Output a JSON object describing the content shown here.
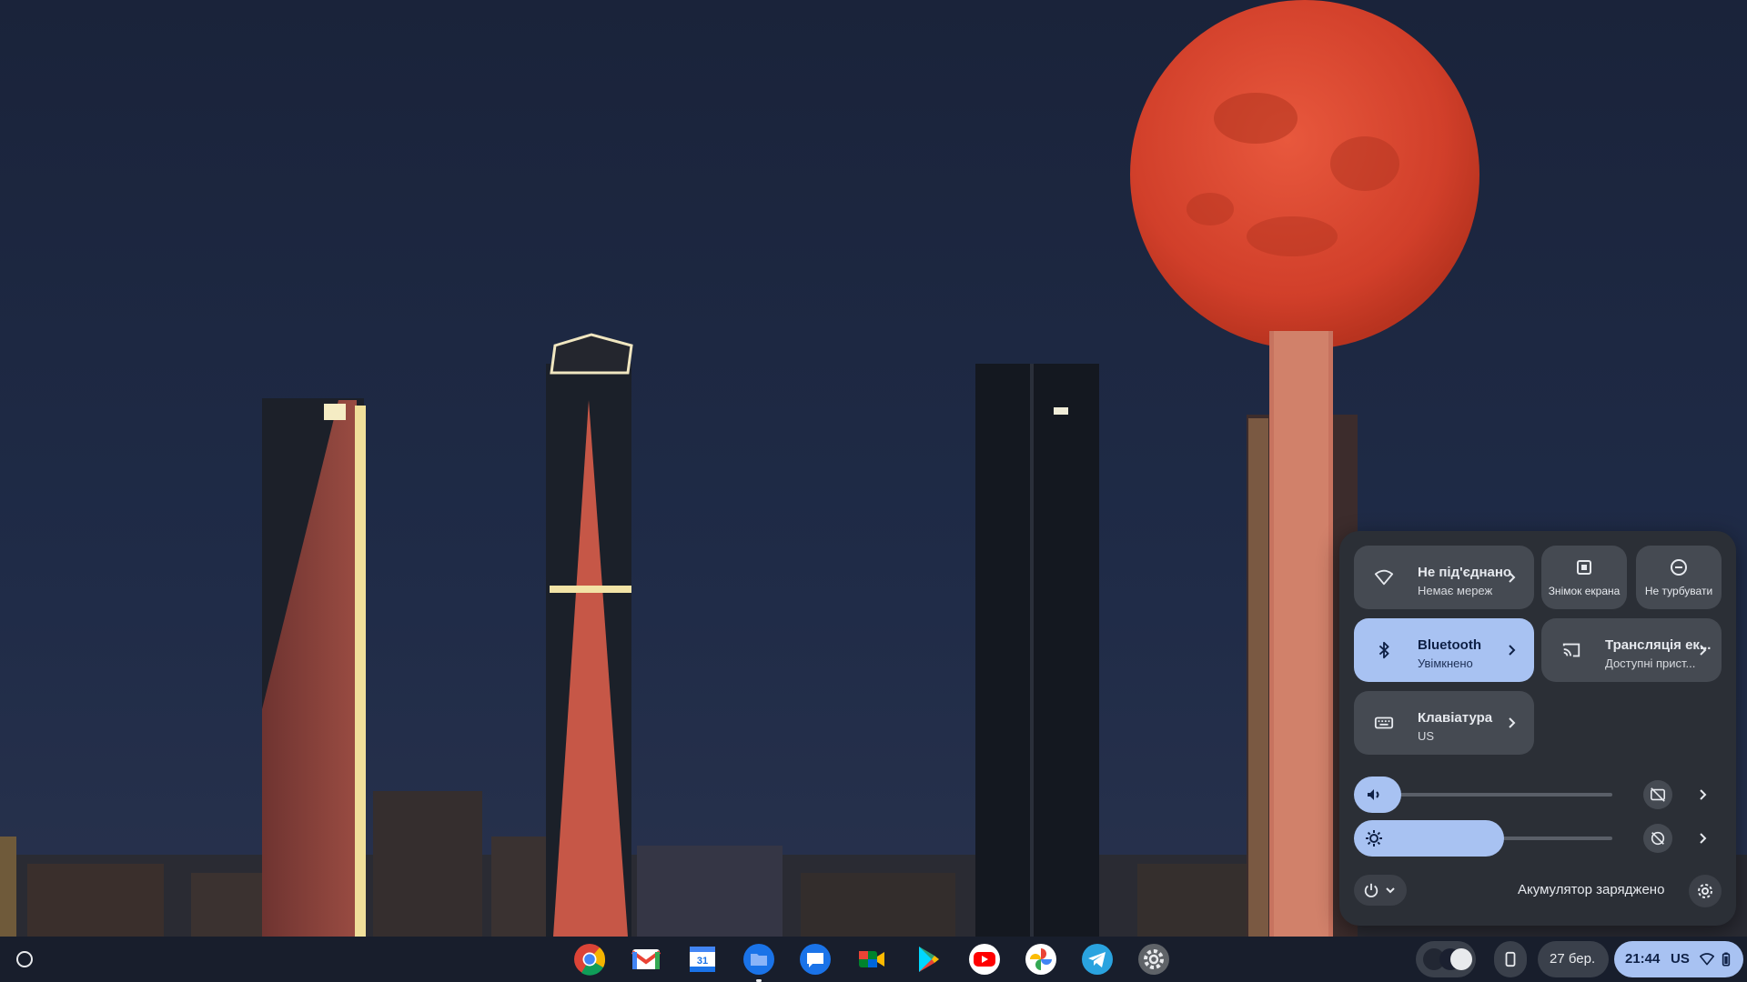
{
  "quick_settings": {
    "network": {
      "title": "Не під'єднано",
      "subtitle": "Немає мереж"
    },
    "screenshot": {
      "label": "Знімок екрана"
    },
    "dnd": {
      "label": "Не турбувати"
    },
    "bluetooth": {
      "title": "Bluetooth",
      "subtitle": "Увімкнено"
    },
    "cast": {
      "title": "Трансляція ек...",
      "subtitle": "Доступні прист..."
    },
    "keyboard": {
      "title": "Клавіатура",
      "subtitle": "US"
    },
    "volume_level": 0.12,
    "brightness_level": 0.58,
    "battery_status": "Акумулятор заряджено"
  },
  "shelf": {
    "apps": [
      "chrome-icon",
      "gmail-icon",
      "calendar-icon",
      "files-icon",
      "messages-icon",
      "meet-icon",
      "play-store-icon",
      "youtube-icon",
      "photos-icon",
      "telegram-icon",
      "settings-icon"
    ],
    "date": "27 бер.",
    "time": "21:44",
    "keyboard_layout": "US"
  },
  "colors": {
    "accent": "#a8c2f2",
    "panel": "#2b2f36",
    "tile": "#454a52",
    "moon": "#d8412c"
  }
}
